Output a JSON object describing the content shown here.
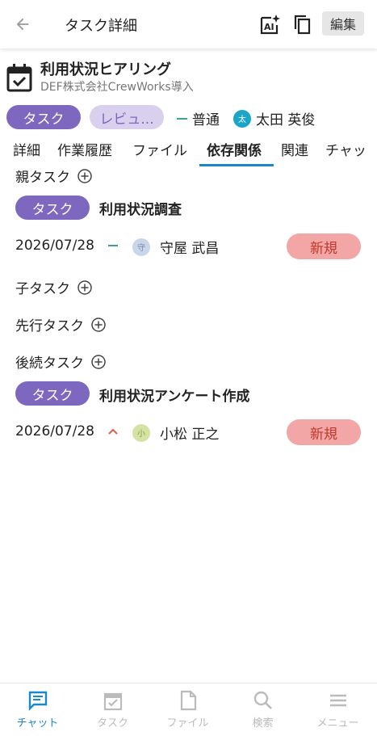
{
  "header": {
    "title": "タスク詳細",
    "edit_label": "編集"
  },
  "task": {
    "title": "利用状況ヒアリング",
    "subtitle": "DEF株式会社CrewWorks導入",
    "type_label": "タスク",
    "status_label": "レビュ...",
    "priority_label": "普通",
    "assignee": {
      "name": "太田 英俊",
      "initial": "太",
      "color": "#1ba6c7"
    }
  },
  "tabs": [
    {
      "label": "詳細"
    },
    {
      "label": "作業履歴"
    },
    {
      "label": "ファイル"
    },
    {
      "label": "依存関係",
      "active": true
    },
    {
      "label": "関連"
    },
    {
      "label": "チャッ"
    }
  ],
  "dependencies": {
    "parent": {
      "label": "親タスク",
      "item": {
        "type_label": "タスク",
        "title": "利用状況調査",
        "date": "2026/07/28",
        "priority": "normal",
        "assignee": {
          "name": "守屋 武昌",
          "initial": "守",
          "color": "#c9d6ea"
        },
        "status": "新規"
      }
    },
    "child": {
      "label": "子タスク"
    },
    "predecessor": {
      "label": "先行タスク"
    },
    "successor": {
      "label": "後続タスク",
      "item": {
        "type_label": "タスク",
        "title": "利用状況アンケート作成",
        "date": "2026/07/28",
        "priority": "high",
        "assignee": {
          "name": "小松 正之",
          "initial": "小",
          "color": "#d4e3a3"
        },
        "status": "新規"
      }
    }
  },
  "bottom_nav": [
    {
      "label": "チャット",
      "icon": "chat-icon",
      "active": true
    },
    {
      "label": "タスク",
      "icon": "task-icon"
    },
    {
      "label": "ファイル",
      "icon": "file-icon"
    },
    {
      "label": "検索",
      "icon": "search-icon"
    },
    {
      "label": "メニュー",
      "icon": "menu-icon"
    }
  ],
  "colors": {
    "accent": "#1a88c9",
    "task_chip": "#7e67bf",
    "review_chip": "#d9d0ee",
    "status_new_bg": "#f2a6a6",
    "status_new_text": "#c0392b",
    "priority_normal": "#3aa87a",
    "priority_high": "#e05a4f"
  }
}
